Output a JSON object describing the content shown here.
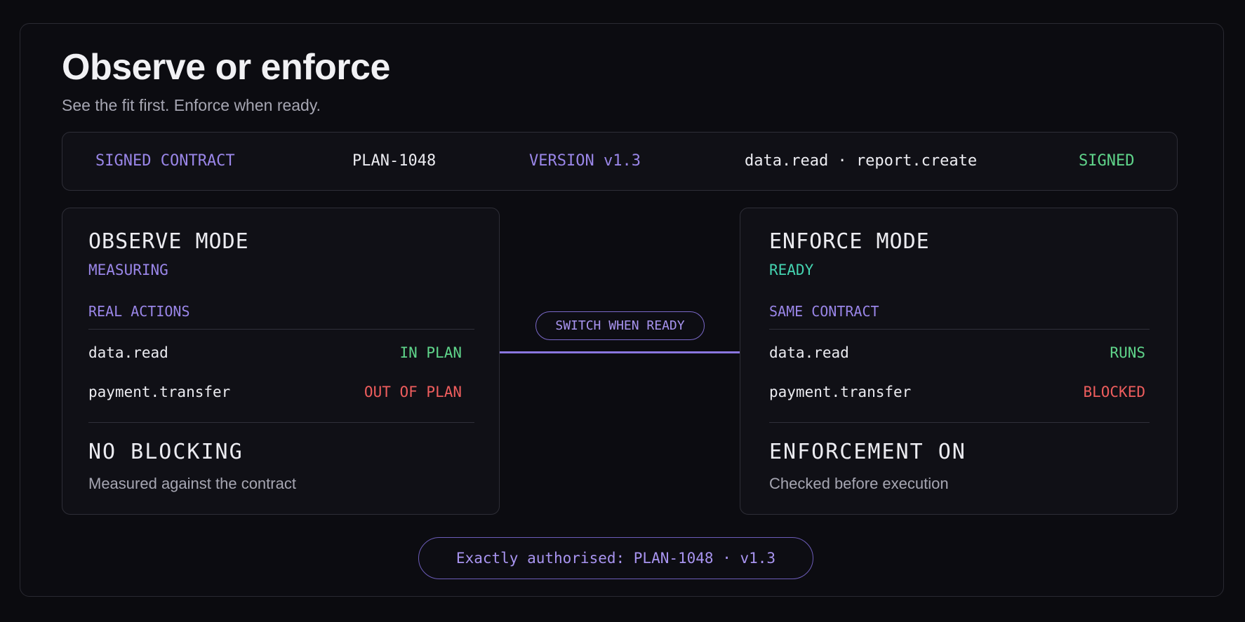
{
  "header": {
    "title": "Observe or enforce",
    "subtitle": "See the fit first. Enforce when ready."
  },
  "contract_bar": {
    "label": "SIGNED CONTRACT",
    "plan_id": "PLAN-1048",
    "version": "VERSION v1.3",
    "scopes": "data.read · report.create",
    "status": "SIGNED"
  },
  "observe_panel": {
    "mode": "OBSERVE MODE",
    "state": "MEASURING",
    "section_label": "REAL ACTIONS",
    "actions": [
      {
        "name": "data.read",
        "result": "IN PLAN"
      },
      {
        "name": "payment.transfer",
        "result": "OUT OF PLAN"
      }
    ],
    "footer_title": "NO BLOCKING",
    "footer_desc": "Measured against the contract"
  },
  "connector": {
    "label": "SWITCH WHEN READY"
  },
  "enforce_panel": {
    "mode": "ENFORCE MODE",
    "state": "READY",
    "section_label": "SAME CONTRACT",
    "actions": [
      {
        "name": "data.read",
        "result": "RUNS"
      },
      {
        "name": "payment.transfer",
        "result": "BLOCKED"
      }
    ],
    "footer_title": "ENFORCEMENT ON",
    "footer_desc": "Checked before execution"
  },
  "authorisation": {
    "text": "Exactly authorised: PLAN-1048 · v1.3"
  },
  "colors": {
    "background": "#0b0b0f",
    "accent_purple": "#9a86e8",
    "success_green": "#5fd48a",
    "danger_red": "#ee5d5d",
    "ready_teal": "#44d3b0"
  }
}
